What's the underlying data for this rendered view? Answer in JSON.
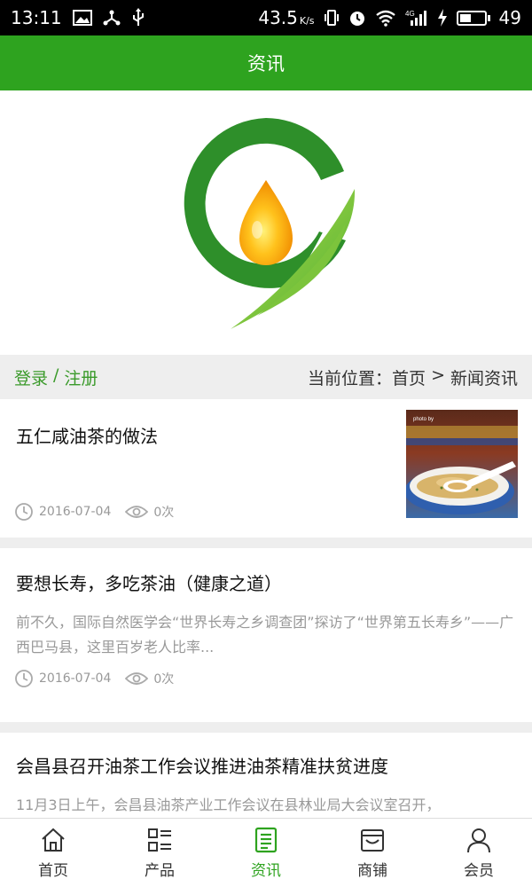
{
  "status_bar": {
    "time": "13:11",
    "speed": "43.5",
    "speed_unit": "K/s",
    "network": "4G",
    "battery": "49",
    "battery_level": 0.49
  },
  "header": {
    "title": "资讯"
  },
  "breadcrumb": {
    "login": "登录",
    "separator": "/",
    "register": "注册",
    "location_label": "当前位置：",
    "home": "首页",
    "arrow": ">",
    "current": "新闻资讯"
  },
  "news": [
    {
      "title": "五仁咸油茶的做法",
      "excerpt": "",
      "date": "2016-07-04",
      "views": "0次",
      "thumb_caption": "photo by"
    },
    {
      "title": "要想长寿，多吃茶油（健康之道）",
      "excerpt": "前不久，国际自然医学会“世界长寿之乡调查团”探访了“世界第五长寿乡”——广西巴马县，这里百岁老人比率...",
      "date": "2016-07-04",
      "views": "0次"
    },
    {
      "title": "会昌县召开油茶工作会议推进油茶精准扶贫进度",
      "excerpt": "11月3日上午，会昌县油茶产业工作会议在县林业局大会议室召开，",
      "date": "",
      "views": ""
    }
  ],
  "bottom_nav": [
    {
      "label": "首页",
      "icon": "home-icon"
    },
    {
      "label": "产品",
      "icon": "grid-list-icon"
    },
    {
      "label": "资讯",
      "icon": "news-icon"
    },
    {
      "label": "商铺",
      "icon": "shop-icon"
    },
    {
      "label": "会员",
      "icon": "user-icon"
    }
  ],
  "colors": {
    "brand_green": "#2ea31f",
    "link_green": "#3a9a2a",
    "divider": "#eeeeee"
  }
}
